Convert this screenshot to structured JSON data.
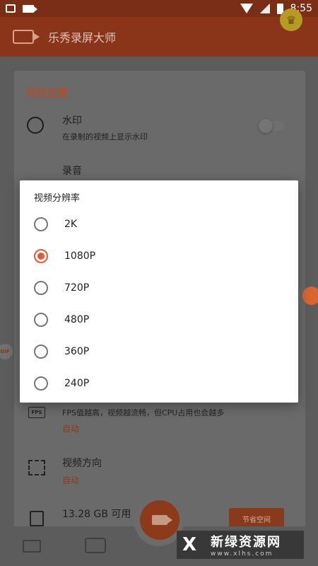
{
  "status_bar": {
    "time": "8:55"
  },
  "app_bar": {
    "title": "乐秀录屏大师"
  },
  "settings": {
    "section_title": "视频设置",
    "watermark": {
      "title": "水印",
      "subtitle": "在录制的视频上显示水印"
    },
    "audio": {
      "title": "录音"
    },
    "fps": {
      "subtitle": "FPS值越高，视频越流畅，但CPU占用也会越多",
      "value": "自动"
    },
    "orientation": {
      "title": "视频方向",
      "value": "自动"
    },
    "storage": {
      "title": "13.28 GB 可用",
      "button": "节省空间"
    }
  },
  "dialog": {
    "title": "视频分辨率",
    "options": [
      {
        "label": "2K",
        "selected": false
      },
      {
        "label": "1080P",
        "selected": true
      },
      {
        "label": "720P",
        "selected": false
      },
      {
        "label": "480P",
        "selected": false
      },
      {
        "label": "360P",
        "selected": false
      },
      {
        "label": "240P",
        "selected": false
      }
    ]
  },
  "floating": {
    "gif_label": "GIF"
  },
  "watermark_overlay": {
    "logo": "X",
    "main": "新绿资源网",
    "sub": "www.xlhs.com"
  },
  "colors": {
    "accent": "#e55a33",
    "app_bar": "#8a3519"
  }
}
